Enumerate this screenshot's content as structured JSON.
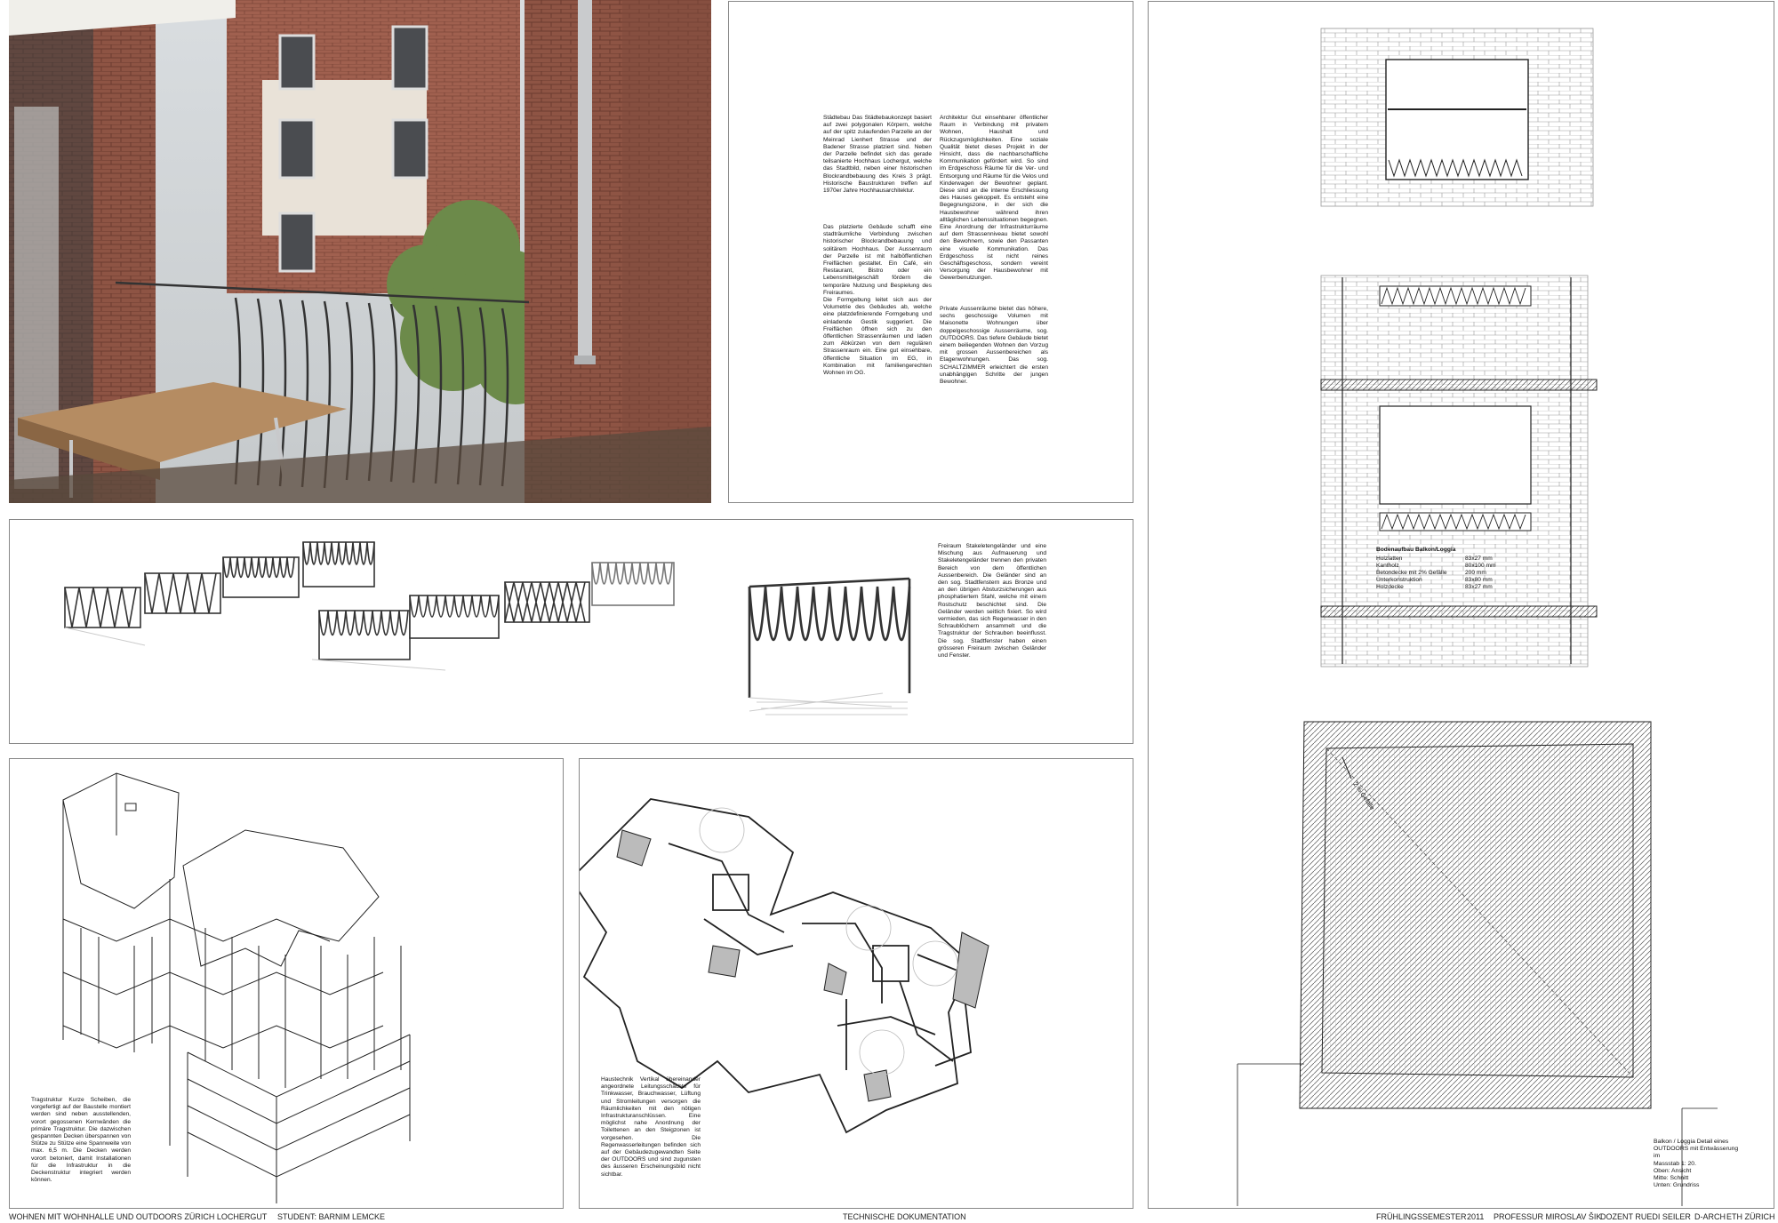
{
  "photo": {
    "alt": "Loggia with balcony railing"
  },
  "intro_text": {
    "col1_p1": "Städtebau Das Städtebaukonzept basiert auf zwei polygonalen Körpern, welche auf der spitz zulaufenden Parzelle an der Meinrad Lienhert Strasse und der Badener Strasse platziert sind. Neben der Parzelle befindet sich das gerade teilsanierte Hochhaus Lochergut, welche das Stadtbild, neben einer historischen Blockrandbebauung des Kreis 3 prägt. Historische Baustrukturen treffen auf 1970er Jahre Hochhausarchitektur.",
    "col1_p2": "Das platzierte Gebäude schafft eine stadträumliche Verbindung zwischen historischer Blockrandbebauung und solitärem Hochhaus. Der Aussenraum der Parzelle ist mit halböffentlichen Freiflächen gestaltet. Ein Café, ein Restaurant, Bistro oder ein Lebensmittelgeschäft fördern die temporäre Nutzung und Bespielung des Freiraumes.\nDie Formgebung leitet sich aus der Volumetrie des Gebäudes ab, welche eine platzdefinierende Formgebung und einladende Gestik suggeriert. Die Freiflächen öffnen sich zu den öffentlichen Strassenräumen und laden zum Abkürzen von dem regulären Strassenraum ein. Eine gut einsehbare, öffentliche Situation im EG, in Kombination mit familiengerechten Wohnen im OG.",
    "col2_p1": "Architektur Gut einsehbarer öffentlicher Raum in Verbindung mit privatem Wohnen, Haushalt und Rückzugsmöglichkeiten. Eine soziale Qualität bietet dieses Projekt in der Hinsicht, dass die nachbarschaftliche Kommunikation gefördert wird. So sind im Erdgeschoss Räume für die Ver- und Entsorgung und Räume für die Velos und Kinderwagen der Bewohner geplant. Diese sind an die interne Erschliessung des Hauses gekoppelt. Es entsteht eine Begegnungszone, in der sich die Hausbewohner während ihren alltäglichen Lebenssituationen begegnen. Eine Anordnung der Infrastrukturräume auf dem Strassenniveau bietet sowohl den Bewohnern, sowie den Passanten eine visuelle Kommunikation. Das Erdgeschoss ist nicht reines Geschäftsgeschoss, sondern vereint Versorgung der Hausbewohner mit Gewerbenutzungen.",
    "col2_p2": "Private Aussenräume bietet das höhere, sechs geschossige Volumen mit Maisonette Wohnungen über doppelgeschossige Aussenräume, sog. OUTDOORS. Das tiefere Gebäude bietet einem beiliegenden Wohnen den Vorzug mit grossen Aussenbereichen als Etagenwohnungen. Das sog. SCHALTZIMMER erleichtert die ersten unabhängigen Schritte der jungen Bewohner."
  },
  "railing_text": "Freiraum Stakeletengeländer und eine Mischung aus Aufmauerung und Stakeletengeländer trennen den privaten Bereich von dem öffentlichen Aussenbereich. Die Geländer sind an den sog. Stadtfenstern aus Bronze und an den übrigen Absturzsicherungen aus phosphatiertem Stahl, welche mit einem Rostschutz beschichtet sind. Die Geländer werden seitlich fixiert. So wird vermieden, das sich Regenwasser in den Schraublöchern ansammelt und die Tragstruktur der Schrauben beeinflusst. Die sog. Stadtfenster haben einen grösseren Freiraum zwischen Geländer und Fenster.",
  "structure_text": "Tragstruktur Kurze Scheiben, die vorgefertigt auf der Baustelle montiert werden sind neben ausstellenden, vorort gegossenen Kernwänden die primäre Tragstruktur. Die dazwischen gespannten Decken überspannen von Stütze zu Stütze eine Spannweite von max. 6,5 m. Die Decken werden vorort betoniert, damit Installationen für die Infrastruktur in die Deckenstruktur integriert werden können.",
  "services_text": "Haustechnik Vertikal übereinander angeordnete Leitungsschächte für Trinkwasser, Brauchwasser, Lüftung und Stromleitungen versorgen die Räumlichkeiten mit den nötigen Infrastrukturanschlüssen. Eine möglichst nahe Anordnung der Toilettenen an den Steigzonen ist vorgesehen. Die Regenwasserleitungen befinden sich auf der Gebäudezugewandten Seite der OUTDOORS und sind zugunsten des äusseren Erscheinungsbild nicht sichtbar.",
  "floor_table": {
    "title": "Bodenaufbau Balkon/Loggia",
    "rows": [
      {
        "label": "Holzlatten",
        "value": "83x27 mm"
      },
      {
        "label": "Kantholz",
        "value": "80x100 mm"
      },
      {
        "label": "Betondecke mit 2% Gefälle",
        "value": "200 mm"
      },
      {
        "label": "Unterkonstruktion",
        "value": "83x80 mm"
      },
      {
        "label": "Holzdecke",
        "value": "83x27 mm"
      }
    ]
  },
  "slope_label": "2 % Gefälle",
  "detail_caption": {
    "line1": "Balkon / Loggia   Detail eines",
    "line2": "OUTDOORS mit Entwässerung im",
    "line3": "Massstab 1: 20.",
    "line4": "Oben: Ansicht",
    "line5": "Mitte: Schnitt",
    "line6": "Unten: Grundriss"
  },
  "footer": {
    "project": "WOHNEN MIT WOHNHALLE UND OUTDOORS ZÜRICH LOCHERGUT",
    "student": "STUDENT: BARNIM LEMCKE",
    "doc": "TECHNISCHE DOKUMENTATION",
    "semester": "FRÜHLINGSSEMESTER",
    "year": "2011",
    "professor": "PROFESSUR MIROSLAV ŠIK",
    "dozent": "DOZENT RUEDI SEILER",
    "dept": "D-ARCH",
    "school": "ETH ZÜRICH"
  }
}
